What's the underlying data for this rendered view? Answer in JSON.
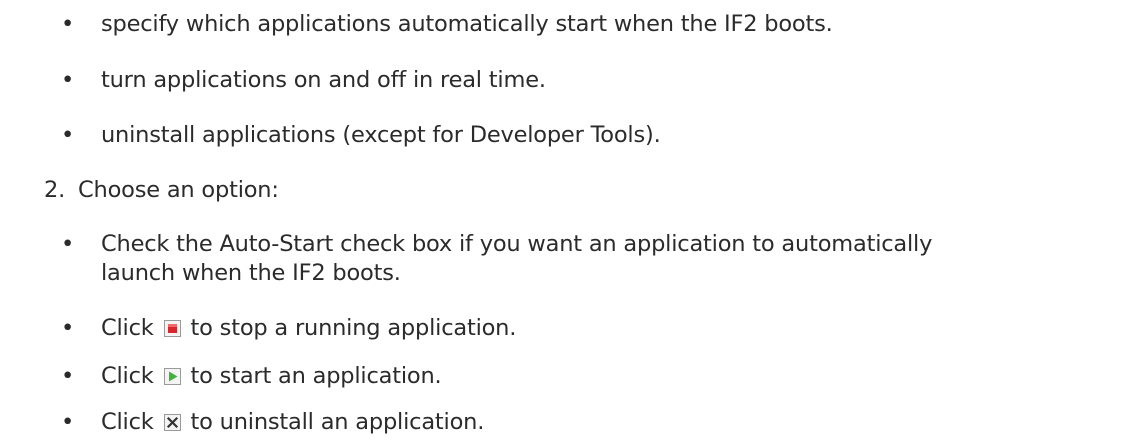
{
  "bullets_top": [
    "specify which applications automatically start when the IF2 boots.",
    "turn applications on and off in real time.",
    "uninstall applications (except for Developer Tools)."
  ],
  "step2": {
    "number": "2.",
    "text": "Choose an option:"
  },
  "option1": {
    "line1": "Check the Auto-Start check box if you want an application to automatically",
    "line2": "launch when the IF2 boots."
  },
  "option2": {
    "prefix": "Click",
    "icon": "stop-icon",
    "suffix": "to stop a running application."
  },
  "option3": {
    "prefix": "Click",
    "icon": "play-icon",
    "suffix": "to start an application."
  },
  "option4": {
    "prefix": "Click",
    "icon": "uninstall-icon",
    "suffix": "to uninstall an application."
  },
  "bullet_glyph": "•",
  "colors": {
    "text": "#2b2b2b",
    "stop_red": "#d9262c",
    "play_green": "#3fb33a",
    "icon_frame": "#9a9a9a"
  }
}
